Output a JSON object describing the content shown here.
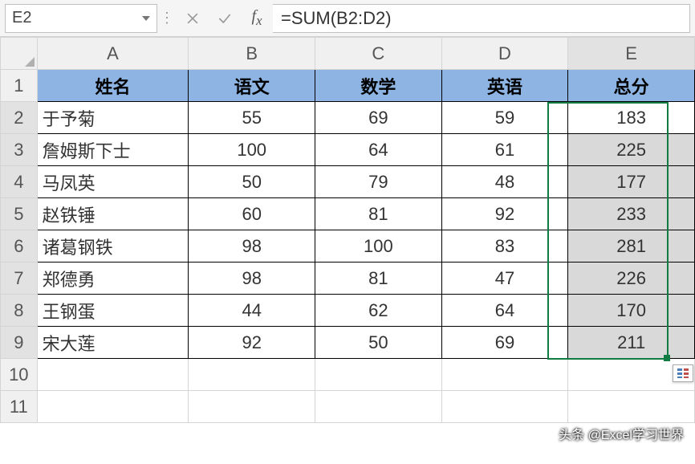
{
  "formula_bar": {
    "cell_ref": "E2",
    "formula": "=SUM(B2:D2)"
  },
  "columns": [
    "A",
    "B",
    "C",
    "D",
    "E"
  ],
  "row_numbers": [
    "1",
    "2",
    "3",
    "4",
    "5",
    "6",
    "7",
    "8",
    "9",
    "10",
    "11"
  ],
  "headers": {
    "name": "姓名",
    "chinese": "语文",
    "math": "数学",
    "english": "英语",
    "total": "总分"
  },
  "rows": [
    {
      "name": "于予菊",
      "chinese": 55,
      "math": 69,
      "english": 59,
      "total": 183
    },
    {
      "name": "詹姆斯下士",
      "chinese": 100,
      "math": 64,
      "english": 61,
      "total": 225
    },
    {
      "name": "马凤英",
      "chinese": 50,
      "math": 79,
      "english": 48,
      "total": 177
    },
    {
      "name": "赵铁锤",
      "chinese": 60,
      "math": 81,
      "english": 92,
      "total": 233
    },
    {
      "name": "诸葛钢铁",
      "chinese": 98,
      "math": 100,
      "english": 83,
      "total": 281
    },
    {
      "name": "郑德勇",
      "chinese": 98,
      "math": 81,
      "english": 47,
      "total": 226
    },
    {
      "name": "王钢蛋",
      "chinese": 44,
      "math": 62,
      "english": 64,
      "total": 170
    },
    {
      "name": "宋大莲",
      "chinese": 92,
      "math": 50,
      "english": 69,
      "total": 211
    }
  ],
  "watermark": "头条 @Excel学习世界",
  "selection": {
    "col": "E",
    "from_row": 2,
    "to_row": 9
  }
}
